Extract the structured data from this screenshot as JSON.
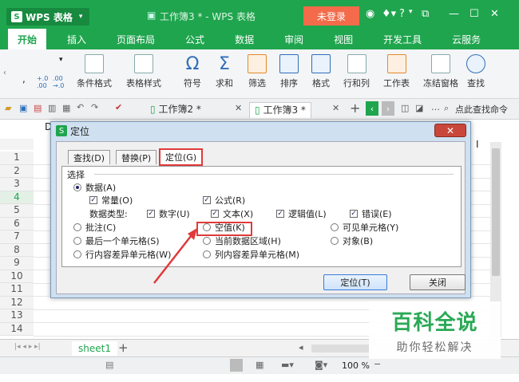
{
  "titlebar": {
    "app_name": "WPS 表格",
    "app_logo": "S",
    "doc_title": "工作簿3 * - WPS 表格",
    "login_label": "未登录",
    "help": "?"
  },
  "ribbon_tabs": [
    "开始",
    "插入",
    "页面布局",
    "公式",
    "数据",
    "审阅",
    "视图",
    "开发工具",
    "云服务"
  ],
  "ribbon": {
    "number_decimal_add": "+.0\n.00",
    "number_decimal_remove": ".00\n→.0",
    "cond_format": "条件格式",
    "table_style": "表格样式",
    "symbol": "符号",
    "sum": "求和",
    "filter": "筛选",
    "sort": "排序",
    "format": "格式",
    "row_col": "行和列",
    "worksheet": "工作表",
    "freeze": "冻结窗格",
    "find": "查找"
  },
  "doc_tabs": {
    "tab1": "工作簿2 *",
    "tab2": "工作簿3 *",
    "search": "点此查找命令"
  },
  "sheet": {
    "rows": [
      "1",
      "2",
      "3",
      "4",
      "5",
      "6",
      "7",
      "8",
      "9",
      "10",
      "11",
      "12",
      "13",
      "14"
    ],
    "selected_row": "4",
    "sheet_tab": "sheet1",
    "add_tab": "+",
    "zoom": "100 %",
    "col_marker": "I",
    "cell_ref_partial": "D"
  },
  "dialog": {
    "title": "定位",
    "logo": "S",
    "close_label": "✕",
    "tabs": [
      "查找(D)",
      "替换(P)",
      "定位(G)"
    ],
    "section": "选择",
    "opt_data": "数据(A)",
    "opt_constant": "常量(O)",
    "opt_formula": "公式(R)",
    "data_type_label": "数据类型:",
    "opt_number": "数字(U)",
    "opt_text": "文本(X)",
    "opt_logical": "逻辑值(L)",
    "opt_error": "错误(E)",
    "opt_comment": "批注(C)",
    "opt_blank": "空值(K)",
    "opt_visible": "可见单元格(Y)",
    "opt_last_cell": "最后一个单元格(S)",
    "opt_current_region": "当前数据区域(H)",
    "opt_object": "对象(B)",
    "opt_row_diff": "行内容差异单元格(W)",
    "opt_col_diff": "列内容差异单元格(M)",
    "btn_goto": "定位(T)",
    "btn_close": "关闭"
  },
  "watermark": {
    "title": "百科全说",
    "subtitle": "助你轻松解决"
  }
}
